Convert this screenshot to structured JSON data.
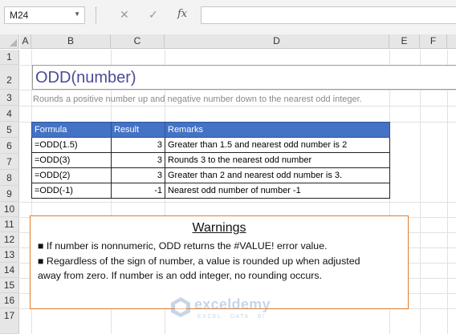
{
  "name_box": "M24",
  "formula_bar": {
    "cancel": "✕",
    "enter": "✓",
    "fx": "fx",
    "content": ""
  },
  "columns": [
    "A",
    "B",
    "C",
    "D",
    "E",
    "F"
  ],
  "rows": [
    "1",
    "2",
    "3",
    "4",
    "5",
    "6",
    "7",
    "8",
    "9",
    "10",
    "11",
    "12",
    "13",
    "14",
    "15",
    "16",
    "17"
  ],
  "sheet": {
    "title": "ODD(number)",
    "subtitle": "Rounds a positive number up and negative number down to the nearest odd integer.",
    "table": {
      "headers": [
        "Formula",
        "Result",
        "Remarks"
      ],
      "rows": [
        [
          "=ODD(1.5)",
          "3",
          "Greater than 1.5 and nearest odd number is 2"
        ],
        [
          "=ODD(3)",
          "3",
          "Rounds 3 to the nearest odd number"
        ],
        [
          "=ODD(2)",
          "3",
          "Greater than 2 and nearest odd number is 3."
        ],
        [
          "=ODD(-1)",
          "-1",
          "Nearest odd number of number -1"
        ]
      ]
    },
    "warnings": {
      "title": "Warnings",
      "line1": "■ If number is nonnumeric, ODD returns the #VALUE! error value.",
      "line2": "■ Regardless of the sign of number, a value is rounded up when adjusted",
      "line3": "away from zero. If number is an odd integer, no rounding occurs."
    }
  },
  "watermark": {
    "name": "exceldemy",
    "tagline": "EXCEL · DATA · BI"
  },
  "colors": {
    "header_fill": "#4472c4",
    "warning_border": "#e07b2c",
    "title_text": "#4a4a9a"
  }
}
